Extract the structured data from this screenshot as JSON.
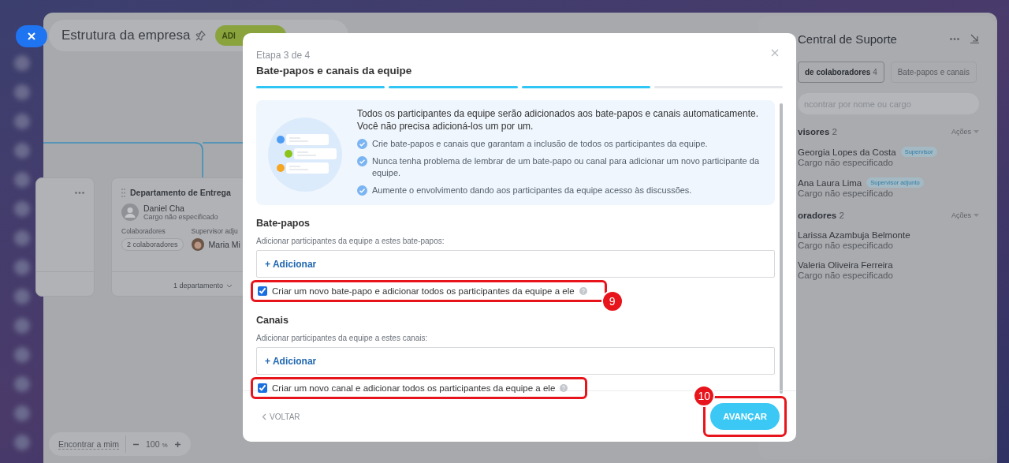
{
  "header": {
    "title": "Estrutura da empresa",
    "add_button": "ADI"
  },
  "department_card": {
    "title": "Departamento de Entrega",
    "head": {
      "name": "Daniel Cha",
      "position": "Cargo não especificado"
    },
    "employees_label": "Colaboradores",
    "employees_count": "2 colaboradores",
    "deputy_label": "Supervisor adju",
    "deputy_name": "Maria Mi",
    "subdepartments": "1 departamento"
  },
  "zoom_bar": {
    "find_me": "Encontrar a mim",
    "value": "100",
    "unit": "%"
  },
  "team_panel": {
    "title": "Central de Suporte",
    "tabs": [
      {
        "label": "de colaboradores",
        "count": "4",
        "selected": true
      },
      {
        "label": "Bate-papos e canais",
        "selected": false
      }
    ],
    "search": {
      "placeholder": "ncontrar por nome ou cargo"
    },
    "groups": [
      {
        "title": "visores",
        "count": "2",
        "actions": "Ações",
        "members": [
          {
            "name": "Georgia Lopes da Costa",
            "role": "Supervisor",
            "position": "Cargo não especificado"
          },
          {
            "name": "Ana Laura Lima",
            "role": "Supervisor adjunto",
            "position": "Cargo não especificado"
          }
        ]
      },
      {
        "title": "oradores",
        "count": "2",
        "actions": "Ações",
        "members": [
          {
            "name": "Larissa Azambuja Belmonte",
            "position": "Cargo não especificado"
          },
          {
            "name": "Valeria Oliveira Ferreira",
            "position": "Cargo não especificado"
          }
        ]
      }
    ]
  },
  "modal": {
    "step": "Etapa 3 de 4",
    "title": "Bate-papos e canais da equipe",
    "steps": [
      {
        "completed": true
      },
      {
        "completed": true
      },
      {
        "completed": true
      },
      {
        "completed": false
      }
    ],
    "intro": "Todos os participantes da equipe serão adicionados aos bate-papos e canais automaticamente. Você não precisa adicioná-los um por um.",
    "benefits": [
      "Crie bate-papos e canais que garantam a inclusão de todos os participantes da equipe.",
      "Nunca tenha problema de lembrar de um bate-papo ou canal para adicionar um novo participante da equipe.",
      "Aumente o envolvimento dando aos participantes da equipe acesso às discussões."
    ],
    "sections": [
      {
        "title": "Bate-papos",
        "hint": "Adicionar participantes da equipe a estes bate-papos:",
        "add_label": "+ Adicionar",
        "option": {
          "label": "Criar um novo bate-papo e adicionar todos os participantes da equipe a ele",
          "checked": true
        },
        "callout": "9"
      },
      {
        "title": "Canais",
        "hint": "Adicionar participantes da equipe a estes canais:",
        "add_label": "+ Adicionar",
        "option": {
          "label": "Criar um novo canal e adicionar todos os participantes da equipe a ele",
          "checked": true
        }
      }
    ],
    "back": "VOLTAR",
    "next": "AVANÇAR",
    "next_callout": "10"
  }
}
